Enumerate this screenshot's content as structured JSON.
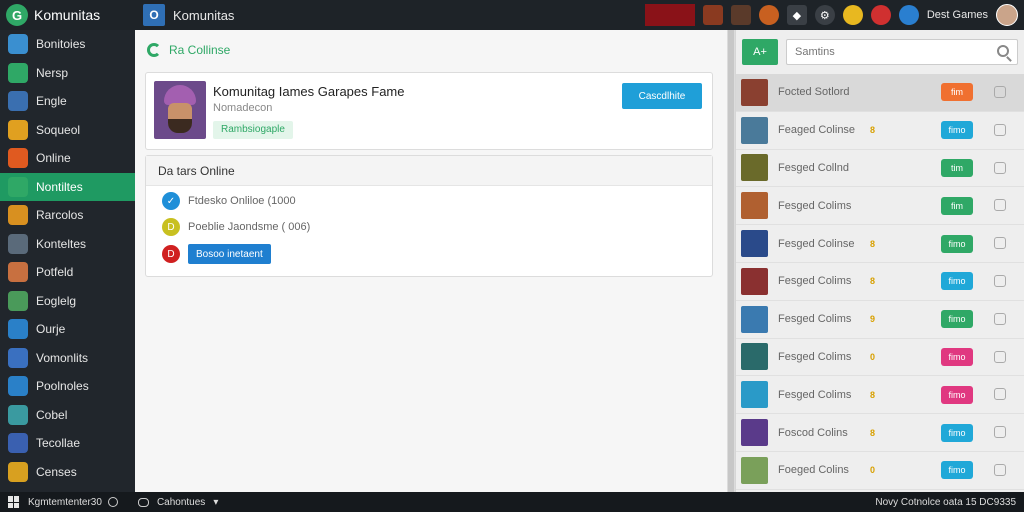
{
  "topbar": {
    "brand": "Komunitas",
    "tab_icon": "O",
    "tab_label": "Komunitas",
    "user_label": "Dest Games"
  },
  "sidebar": {
    "items": [
      {
        "label": "Bonitoies",
        "icon_color": "#3a8fd0",
        "icon": "people-icon"
      },
      {
        "label": "Nersp",
        "icon_color": "#2fa866",
        "icon": "globe-icon"
      },
      {
        "label": "Engle",
        "icon_color": "#3a6fb0",
        "icon": "game-icon"
      },
      {
        "label": "Soqueol",
        "icon_color": "#e0a020",
        "icon": "coin-icon"
      },
      {
        "label": "Online",
        "icon_color": "#e05a20",
        "icon": "browser-icon"
      },
      {
        "label": "Nontiltes",
        "icon_color": "#2fa866",
        "icon": "chat-icon",
        "active": true
      },
      {
        "label": "Rarcolos",
        "icon_color": "#d89020",
        "icon": "folder-icon"
      },
      {
        "label": "Konteltes",
        "icon_color": "#5a6a7a",
        "icon": "shield-icon"
      },
      {
        "label": "Potfeld",
        "icon_color": "#c87040",
        "icon": "avatar-icon"
      },
      {
        "label": "Eoglelg",
        "icon_color": "#4a9a5a",
        "icon": "tree-icon"
      },
      {
        "label": "Ourje",
        "icon_color": "#2a80c8",
        "icon": "globe-icon"
      },
      {
        "label": "Vomonlits",
        "icon_color": "#3a70c0",
        "icon": "people-icon"
      },
      {
        "label": "Poolnoles",
        "icon_color": "#2a80c8",
        "icon": "document-icon"
      },
      {
        "label": "Cobel",
        "icon_color": "#3a9aa0",
        "icon": "file-icon"
      },
      {
        "label": "Tecollae",
        "icon_color": "#3a60b0",
        "icon": "grid-icon"
      },
      {
        "label": "Censes",
        "icon_color": "#d8a020",
        "icon": "image-icon"
      }
    ]
  },
  "main": {
    "head_label": "Ra Collinse",
    "profile": {
      "title": "Komunitag Iames Garapes Fame",
      "subtitle": "Nomadecon",
      "badge": "Rambsiogaple",
      "button": "Cascdlhite"
    },
    "online": {
      "title": "Da tars Online",
      "rows": [
        {
          "text": "Ftdesko Onliloe (1000",
          "color": "#1f8fd8",
          "glyph": "✓"
        },
        {
          "text": "Poeblie Jaondsme ( 006)",
          "color": "#c8c020",
          "glyph": "D"
        },
        {
          "text": "",
          "color": "#d02020",
          "glyph": "D",
          "button": "Bosoo inetaent"
        }
      ]
    }
  },
  "right": {
    "add_label": "A+",
    "search_placeholder": "Samtins",
    "games": [
      {
        "name": "Focted Sotlord",
        "tag": "",
        "status": "fim",
        "status_color": "#f07030",
        "thumb": "#8a4030"
      },
      {
        "name": "Feaged Colinse",
        "tag": "8",
        "status": "fimo",
        "status_color": "#20a8d8",
        "thumb": "#4a7a9a"
      },
      {
        "name": "Fesged Collnd",
        "tag": "",
        "status": "tim",
        "status_color": "#2fa866",
        "thumb": "#6a6a2a"
      },
      {
        "name": "Fesged Colims",
        "tag": "",
        "status": "fim",
        "status_color": "#2fa866",
        "thumb": "#b06030"
      },
      {
        "name": "Fesged Colinse",
        "tag": "8",
        "status": "fimo",
        "status_color": "#2fa866",
        "thumb": "#2a4a8a"
      },
      {
        "name": "Fesged Colims",
        "tag": "8",
        "status": "fimo",
        "status_color": "#20a8d8",
        "thumb": "#8a3030"
      },
      {
        "name": "Fesged Colims",
        "tag": "9",
        "status": "fimo",
        "status_color": "#2fa866",
        "thumb": "#3a7ab0"
      },
      {
        "name": "Fesged Colims",
        "tag": "0",
        "status": "fimo",
        "status_color": "#e03880",
        "thumb": "#2a6a6a"
      },
      {
        "name": "Fesged Colims",
        "tag": "8",
        "status": "fimo",
        "status_color": "#e03880",
        "thumb": "#2a9ac8"
      },
      {
        "name": "Foscod Colins",
        "tag": "8",
        "status": "fimo",
        "status_color": "#20a8d8",
        "thumb": "#5a3a8a"
      },
      {
        "name": "Foeged Colins",
        "tag": "0",
        "status": "fimo",
        "status_color": "#20a8d8",
        "thumb": "#7aa05a"
      }
    ]
  },
  "taskbar": {
    "left_label": "Kgmtemtenter30",
    "app_label": "Cahontues",
    "right_label": "Novy Cotnolce oata 15 DC9335"
  }
}
